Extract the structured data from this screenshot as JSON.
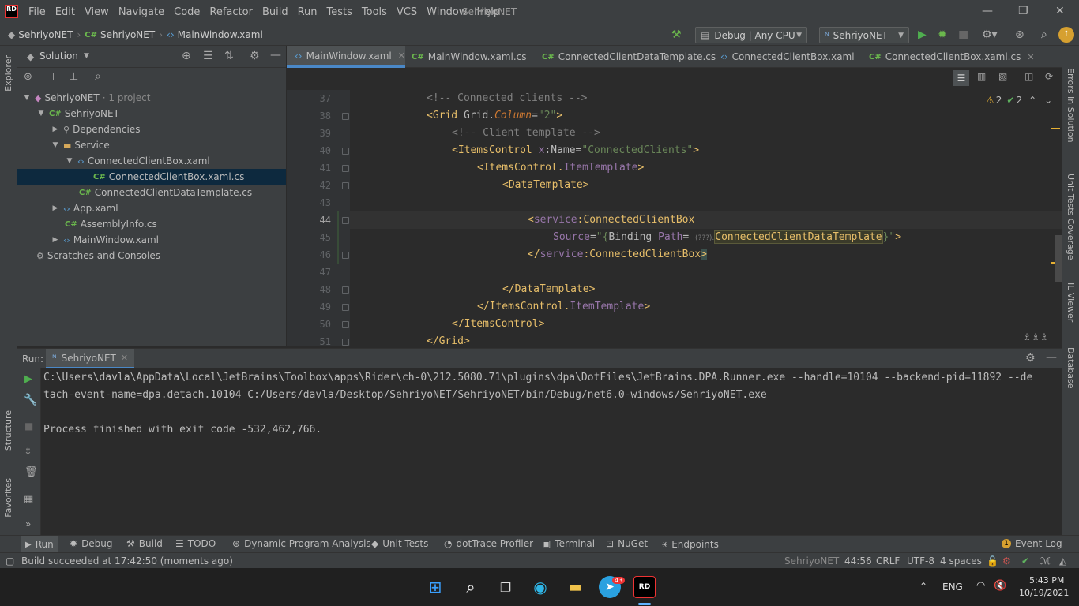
{
  "app": {
    "title": "SehriyoNET",
    "logo": "RD"
  },
  "menu": [
    "File",
    "Edit",
    "View",
    "Navigate",
    "Code",
    "Refactor",
    "Build",
    "Run",
    "Tests",
    "Tools",
    "VCS",
    "Window",
    "Help"
  ],
  "breadcrumb": [
    "SehriyoNET",
    "SehriyoNET",
    "MainWindow.xaml"
  ],
  "toolbar": {
    "config": "Debug | Any CPU",
    "run_config": "SehriyoNET"
  },
  "solution": {
    "title": "Solution"
  },
  "left_strip": {
    "explorer": "Explorer",
    "structure": "Structure",
    "favorites": "Favorites"
  },
  "right_strip": {
    "errors": "Errors In Solution",
    "unit_tests": "Unit Tests Coverage",
    "il_viewer": "IL Viewer",
    "database": "Database"
  },
  "tree": [
    {
      "label": "SehriyoNET",
      "suffix": "· 1 project"
    },
    {
      "label": "SehriyoNET"
    },
    {
      "label": "Dependencies"
    },
    {
      "label": "Service"
    },
    {
      "label": "ConnectedClientBox.xaml"
    },
    {
      "label": "ConnectedClientBox.xaml.cs"
    },
    {
      "label": "ConnectedClientDataTemplate.cs"
    },
    {
      "label": "App.xaml"
    },
    {
      "label": "AssemblyInfo.cs"
    },
    {
      "label": "MainWindow.xaml"
    },
    {
      "label": "Scratches and Consoles"
    }
  ],
  "tabs": [
    "MainWindow.xaml",
    "MainWindow.xaml.cs",
    "ConnectedClientDataTemplate.cs",
    "ConnectedClientBox.xaml",
    "ConnectedClientBox.xaml.cs"
  ],
  "editor": {
    "line_numbers": [
      "37",
      "38",
      "39",
      "40",
      "41",
      "42",
      "43",
      "44",
      "45",
      "46",
      "47",
      "48",
      "49",
      "50",
      "51"
    ],
    "warnings": "2",
    "checks": "2",
    "hint": "(???)."
  },
  "run": {
    "label": "Run:",
    "tab": "SehriyoNET",
    "console_line1": "C:\\Users\\davla\\AppData\\Local\\JetBrains\\Toolbox\\apps\\Rider\\ch-0\\212.5080.71\\plugins\\dpa\\DotFiles\\JetBrains.DPA.Runner.exe --handle=10104 --backend-pid=11892 --de",
    "console_line2": "tach-event-name=dpa.detach.10104 C:/Users/davla/Desktop/SehriyoNET/SehriyoNET/bin/Debug/net6.0-windows/SehriyoNET.exe",
    "console_line3": "Process finished with exit code -532,462,766."
  },
  "bottom_tabs": [
    "Run",
    "Debug",
    "Build",
    "TODO",
    "Dynamic Program Analysis",
    "Unit Tests",
    "dotTrace Profiler",
    "Terminal",
    "NuGet",
    "Endpoints"
  ],
  "event_log": "Event Log",
  "status": {
    "message": "Build succeeded at 17:42:50 (moments ago)",
    "project": "SehriyoNET",
    "position": "44:56",
    "line_sep": "CRLF",
    "encoding": "UTF-8",
    "indent": "4 spaces"
  },
  "taskbar": {
    "telegram_badge": "43",
    "lang": "ENG",
    "time": "5:43 PM",
    "date": "10/19/2021"
  }
}
